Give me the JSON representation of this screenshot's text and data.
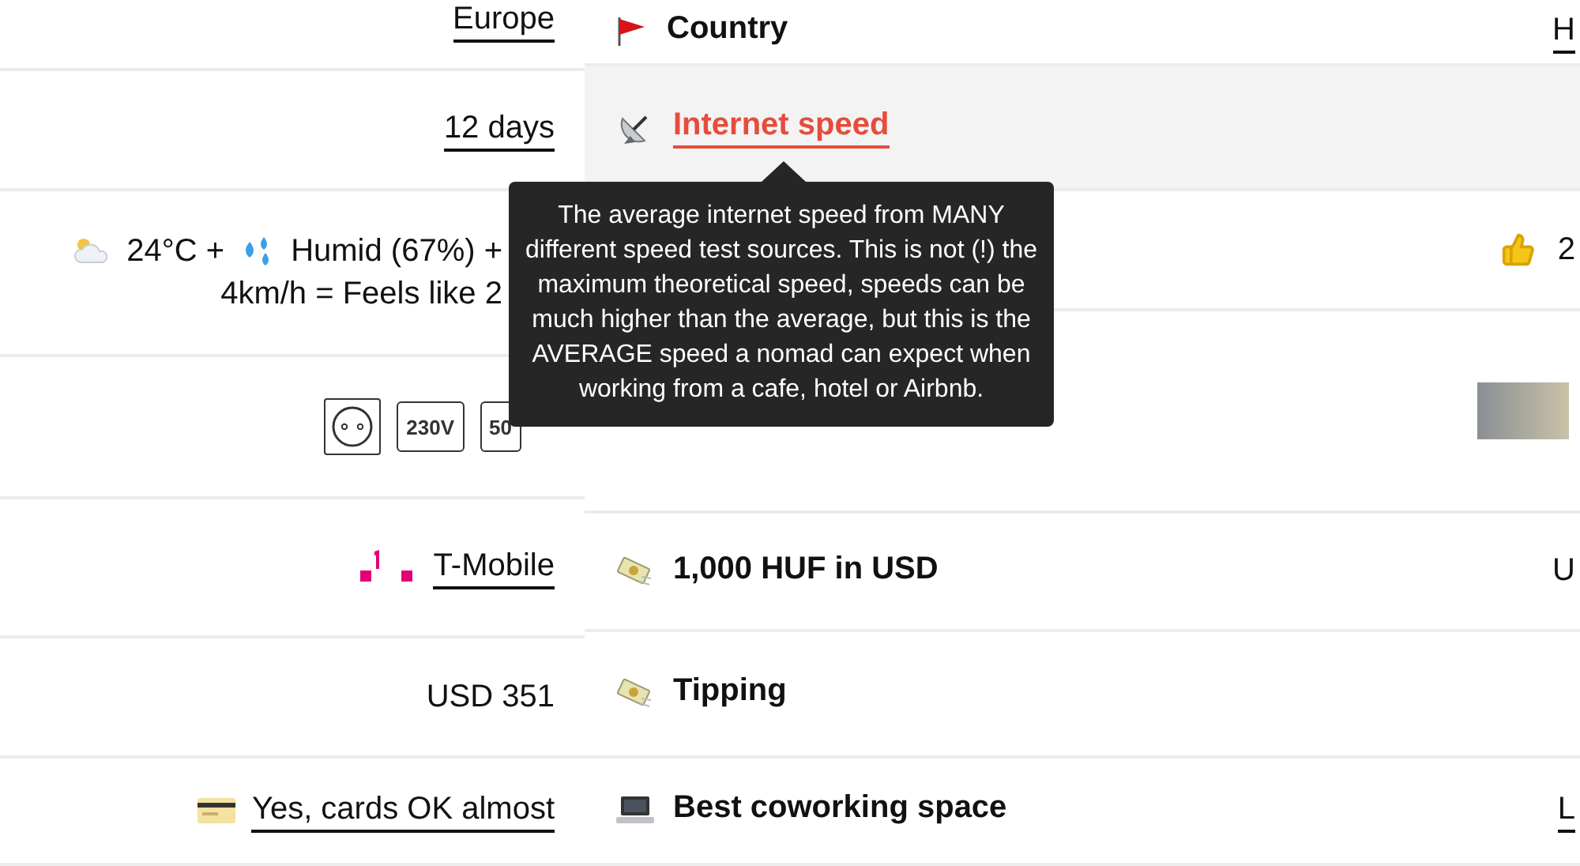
{
  "left_column": {
    "rows": [
      {
        "kind": "link",
        "value": "Europe"
      },
      {
        "kind": "link",
        "value": "12 days"
      },
      {
        "kind": "weather",
        "temperature": "24°C +",
        "humidity": "Humid (67%) +",
        "wind": "4km/h = Feels like 2"
      },
      {
        "kind": "plugs",
        "badges": [
          "230V",
          "50"
        ]
      },
      {
        "kind": "carrier",
        "value": "T-Mobile"
      },
      {
        "kind": "text",
        "value": "USD 351"
      },
      {
        "kind": "card",
        "value": "Yes, cards OK almost"
      }
    ]
  },
  "right_column": {
    "rows": [
      {
        "kind": "flag",
        "label": "Country",
        "selected": false,
        "value": {
          "kind": "link",
          "text": "H"
        }
      },
      {
        "kind": "satellite",
        "label": "Internet speed",
        "selected": true
      },
      {
        "kind": "hidden",
        "selected": false,
        "value": {
          "kind": "thumbs",
          "text": "2"
        }
      },
      {
        "kind": "hidden",
        "selected": false,
        "value": {
          "kind": "photo"
        }
      },
      {
        "kind": "money",
        "label": "1,000 HUF in USD",
        "selected": false,
        "value": {
          "kind": "text",
          "text": "U"
        }
      },
      {
        "kind": "money",
        "label": "Tipping",
        "selected": false
      },
      {
        "kind": "laptop",
        "label": "Best coworking space",
        "selected": false,
        "value": {
          "kind": "link",
          "text": "L"
        }
      }
    ]
  },
  "tooltip": {
    "text": "The average internet speed from MANY different speed test sources. This is not (!) the maximum theoretical speed, speeds can be much higher than the average, but this is the AVERAGE speed a nomad can expect when working from a cafe, hotel or Airbnb."
  }
}
